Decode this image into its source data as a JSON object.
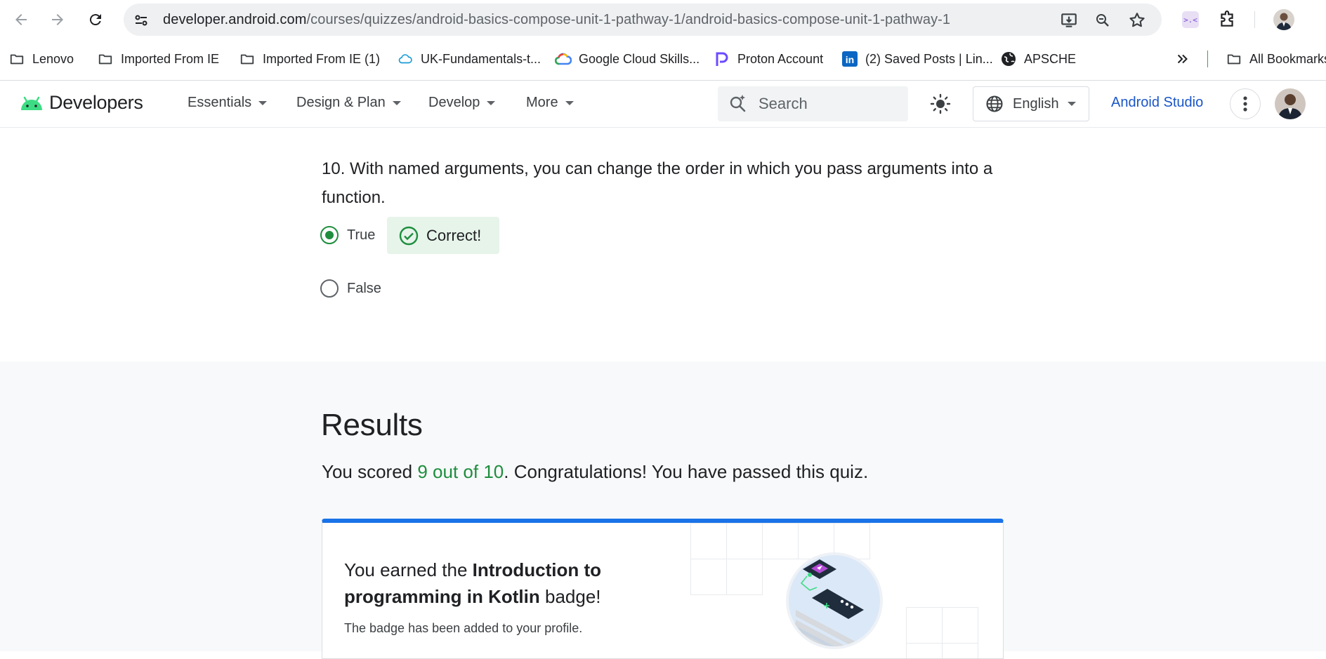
{
  "browser": {
    "url_host": "developer.android.com",
    "url_path": "/courses/quizzes/android-basics-compose-unit-1-pathway-1/android-basics-compose-unit-1-pathway-1",
    "bookmarks": [
      "Lenovo",
      "Imported From IE",
      "Imported From IE (1)",
      "UK-Fundamentals-t...",
      "Google Cloud Skills...",
      "Proton Account",
      "(2) Saved Posts | Lin...",
      "APSCHE"
    ],
    "all_bookmarks": "All Bookmarks"
  },
  "header": {
    "logo_text": "Developers",
    "nav": [
      "Essentials",
      "Design & Plan",
      "Develop",
      "More"
    ],
    "search_placeholder": "Search",
    "language": "English",
    "studio_link": "Android Studio"
  },
  "quiz": {
    "number": "10.",
    "question": "With named arguments, you can change the order in which you pass arguments into a function.",
    "options": [
      {
        "label": "True",
        "selected": true
      },
      {
        "label": "False",
        "selected": false
      }
    ],
    "feedback": "Correct!"
  },
  "results": {
    "title": "Results",
    "score_prefix": "You scored ",
    "score": "9 out of 10",
    "score_suffix": ". Congratulations! You have passed this quiz.",
    "badge_prefix": "You earned the ",
    "badge_name": "Introduction to programming in Kotlin",
    "badge_suffix": " badge!",
    "badge_note": "The badge has been added to your profile."
  },
  "colors": {
    "accent_green": "#1e8e3e",
    "link_blue": "#1a56c8",
    "card_top": "#1a73e8",
    "android_green": "#3ddc84"
  }
}
